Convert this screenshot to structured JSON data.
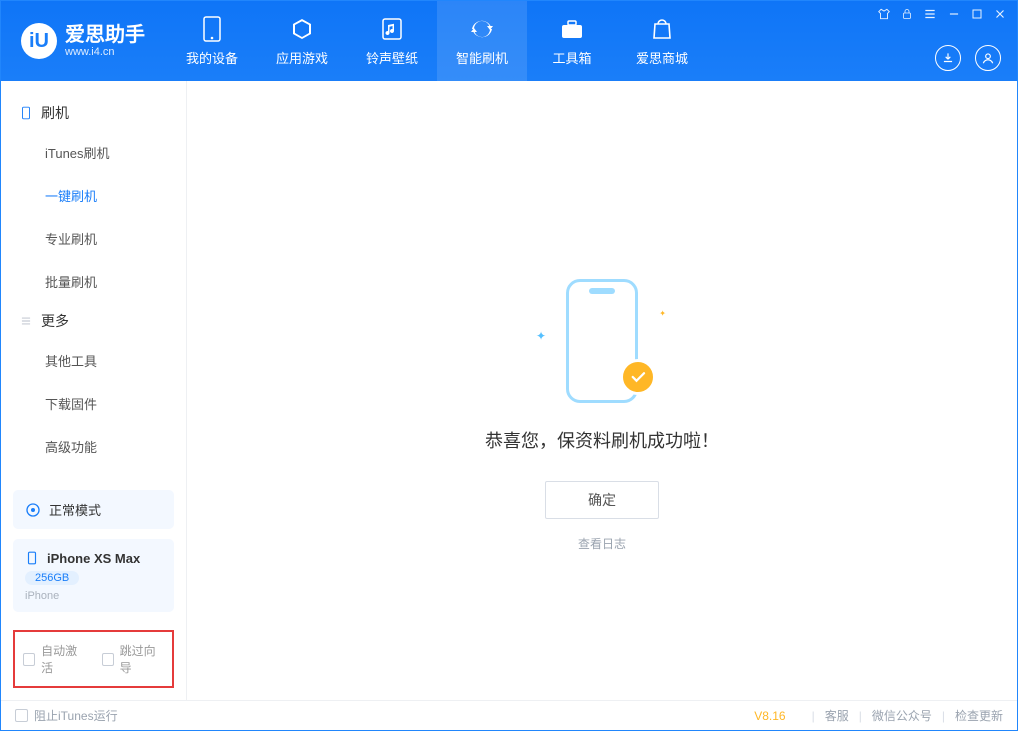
{
  "app": {
    "name": "爱思助手",
    "site": "www.i4.cn"
  },
  "tabs": [
    {
      "label": "我的设备"
    },
    {
      "label": "应用游戏"
    },
    {
      "label": "铃声壁纸"
    },
    {
      "label": "智能刷机"
    },
    {
      "label": "工具箱"
    },
    {
      "label": "爱思商城"
    }
  ],
  "sidebar": {
    "group1": {
      "title": "刷机",
      "items": [
        {
          "label": "iTunes刷机"
        },
        {
          "label": "一键刷机"
        },
        {
          "label": "专业刷机"
        },
        {
          "label": "批量刷机"
        }
      ]
    },
    "group2": {
      "title": "更多",
      "items": [
        {
          "label": "其他工具"
        },
        {
          "label": "下载固件"
        },
        {
          "label": "高级功能"
        }
      ]
    },
    "mode_label": "正常模式",
    "device": {
      "name": "iPhone XS Max",
      "storage": "256GB",
      "type": "iPhone"
    },
    "options": {
      "auto_activate": "自动激活",
      "skip_guide": "跳过向导"
    }
  },
  "main": {
    "success_msg": "恭喜您，保资料刷机成功啦！",
    "ok_btn": "确定",
    "view_log": "查看日志"
  },
  "footer": {
    "block_itunes": "阻止iTunes运行",
    "version": "V8.16",
    "service": "客服",
    "wechat": "微信公众号",
    "update": "检查更新"
  }
}
